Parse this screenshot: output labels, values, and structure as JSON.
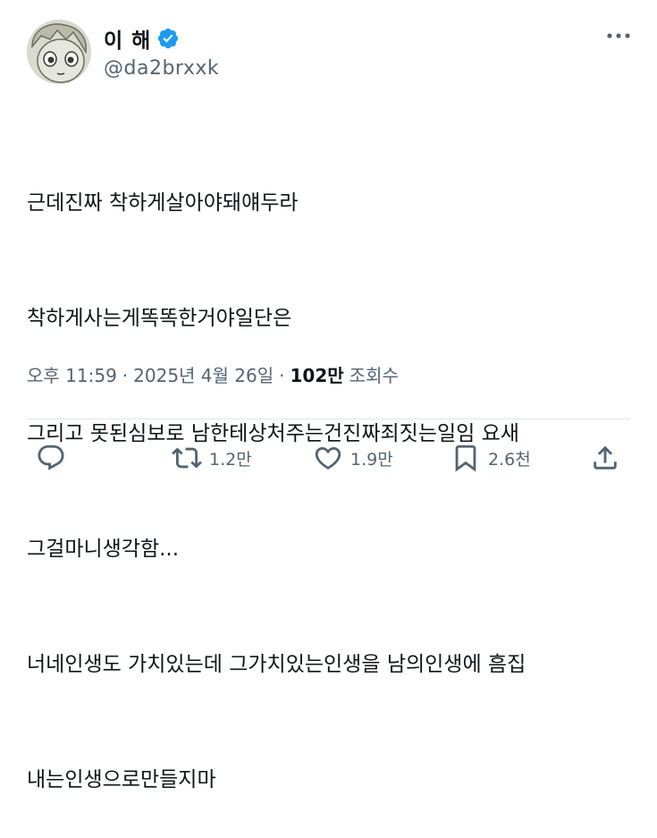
{
  "user": {
    "display_name": "이 해",
    "handle": "@da2brxxk",
    "verified_color": "#1d9bf0"
  },
  "tweet": {
    "lines": [
      "근데진짜 착하게살아야돼얘두라",
      "착하게사는게똑똑한거야일단은",
      "그리고 못된심보로 남한테상처주는건진짜죄짓는일임 요새",
      "그걸마니생각함...",
      "너네인생도 가치있는데 그가치있는인생을 남의인생에 흠집",
      "내는인생으로만들지마"
    ]
  },
  "meta": {
    "time": "오후 11:59",
    "separator1": "·",
    "date": "2025년 4월 26일",
    "separator2": "·",
    "views_count": "102만",
    "views_label": "조회수"
  },
  "actions": {
    "reply": {
      "icon": "reply-icon",
      "count": ""
    },
    "retweet": {
      "icon": "retweet-icon",
      "count": "1.2만"
    },
    "like": {
      "icon": "heart-icon",
      "count": "1.9만"
    },
    "bookmark": {
      "icon": "bookmark-icon",
      "count": "2.6천"
    },
    "share": {
      "icon": "share-icon",
      "count": ""
    }
  },
  "colors": {
    "text": "#0f1419",
    "secondary": "#536471",
    "divider": "#e1e6ea"
  }
}
